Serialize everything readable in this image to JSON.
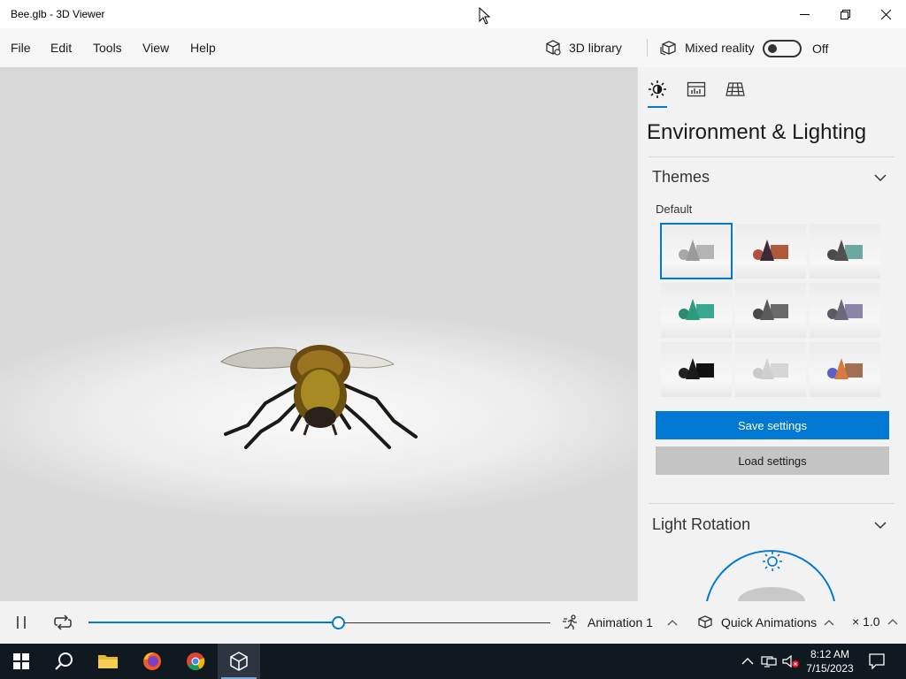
{
  "window": {
    "title": "Bee.glb - 3D Viewer"
  },
  "menu": {
    "items": [
      "File",
      "Edit",
      "Tools",
      "View",
      "Help"
    ]
  },
  "commands": {
    "library_label": "3D library",
    "mixed_reality_label": "Mixed reality",
    "toggle_state_label": "Off"
  },
  "panel": {
    "title": "Environment & Lighting",
    "tabs": [
      "sun-icon",
      "stats-icon",
      "grid-icon"
    ],
    "themes": {
      "title": "Themes",
      "selected_label": "Default",
      "swatches": [
        {
          "name": "default",
          "primary": "#9a9a9a",
          "secondary": "#b4b4b4",
          "ball": "#a8a8a8",
          "selected": true
        },
        {
          "name": "copper",
          "primary": "#3a2a3a",
          "secondary": "#b0583a",
          "ball": "#b05040"
        },
        {
          "name": "teal-grey",
          "primary": "#505050",
          "secondary": "#6aa8a0",
          "ball": "#4a4a4a"
        },
        {
          "name": "emerald",
          "primary": "#2e9a7c",
          "secondary": "#3aa890",
          "ball": "#2a8a70"
        },
        {
          "name": "graphite",
          "primary": "#5a5a5a",
          "secondary": "#6a6a6a",
          "ball": "#4a4a4a"
        },
        {
          "name": "lavender",
          "primary": "#6a6a7a",
          "secondary": "#8a84a8",
          "ball": "#5a5a60"
        },
        {
          "name": "noir",
          "primary": "#1a1a1a",
          "secondary": "#111111",
          "ball": "#222222"
        },
        {
          "name": "ghost",
          "primary": "#cfcfcf",
          "secondary": "#d6d6d6",
          "ball": "#cacaca"
        },
        {
          "name": "sunset",
          "primary": "#d87a40",
          "secondary": "#a07050",
          "ball": "#5a60c8"
        }
      ]
    },
    "save_label": "Save settings",
    "load_label": "Load settings",
    "light_rotation": {
      "title": "Light Rotation"
    }
  },
  "animation": {
    "progress": 0.541,
    "animation_name": "Animation 1",
    "quick_label": "Quick Animations",
    "speed_label": "× 1.0"
  },
  "taskbar": {
    "time": "8:12 AM",
    "date": "7/15/2023",
    "apps": [
      "windows-start-icon",
      "search-icon",
      "file-explorer-icon",
      "firefox-icon",
      "chrome-icon",
      "3d-viewer-icon"
    ]
  },
  "colors": {
    "accent": "#0078d4",
    "taskbar": "#101820"
  }
}
